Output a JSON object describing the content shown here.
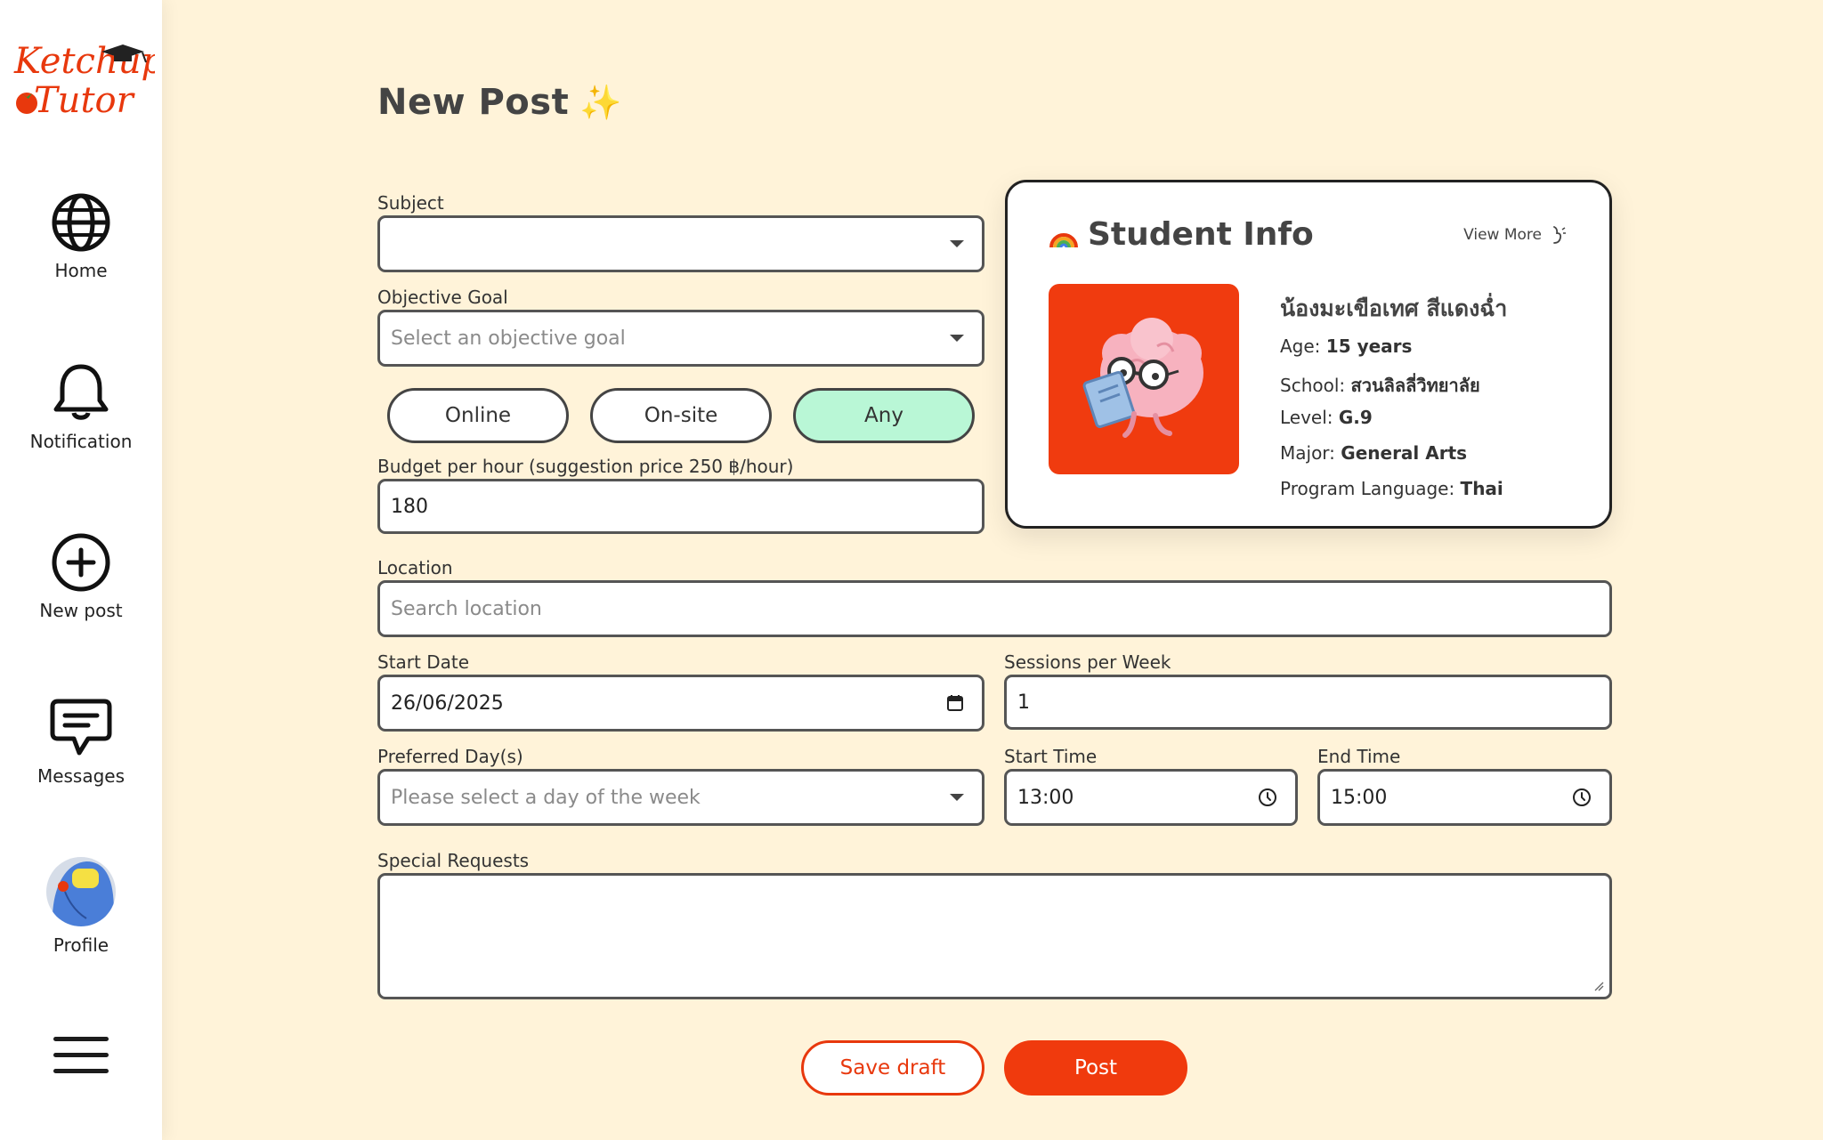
{
  "brand": {
    "line1": "Ketchup",
    "line2": "Tutor",
    "color": "#e8380d"
  },
  "nav": {
    "home": "Home",
    "notification": "Notification",
    "new_post": "New post",
    "messages": "Messages",
    "profile": "Profile"
  },
  "page": {
    "title": "New Post"
  },
  "form": {
    "subject": {
      "label": "Subject",
      "value": ""
    },
    "objective": {
      "label": "Objective Goal",
      "placeholder": "Select an objective goal"
    },
    "modes": [
      "Online",
      "On-site",
      "Any"
    ],
    "selected_mode": "Any",
    "budget": {
      "label": "Budget per hour (suggestion price 250 ฿/hour)",
      "value": "180"
    },
    "location": {
      "label": "Location",
      "placeholder": "Search location"
    },
    "start_date": {
      "label": "Start Date",
      "value": "26/06/2025"
    },
    "sessions": {
      "label": "Sessions per Week",
      "value": "1"
    },
    "preferred_days": {
      "label": "Preferred Day(s)",
      "placeholder": "Please select a day of the week"
    },
    "start_time": {
      "label": "Start Time",
      "value": "13:00"
    },
    "end_time": {
      "label": "End Time",
      "value": "15:00"
    },
    "special_requests": {
      "label": "Special Requests",
      "value": ""
    }
  },
  "student": {
    "title": "Student Info",
    "view_more": "View More",
    "name": "น้องมะเขือเทศ สีแดงฉ่ำ",
    "rows": [
      {
        "key": "Age:",
        "value": "15 years"
      },
      {
        "key": "School:",
        "value": "สวนลิลลี่วิทยาลัย"
      },
      {
        "key": "Level:",
        "value": "G.9"
      },
      {
        "key": "Major:",
        "value": "General Arts"
      },
      {
        "key": "Program Language:",
        "value": "Thai"
      }
    ]
  },
  "actions": {
    "save_draft": "Save draft",
    "post": "Post"
  },
  "colors": {
    "accent": "#f03a0d",
    "any_active": "#b9f7d6",
    "background": "#fff3d9"
  },
  "icons": [
    "globe-icon",
    "bell-icon",
    "plus-circle-icon",
    "chat-icon",
    "menu-icon",
    "calendar-icon",
    "clock-icon",
    "chevron-down-icon",
    "rainbow-icon",
    "star-icon",
    "graduation-cap-icon",
    "tomato-icon"
  ]
}
